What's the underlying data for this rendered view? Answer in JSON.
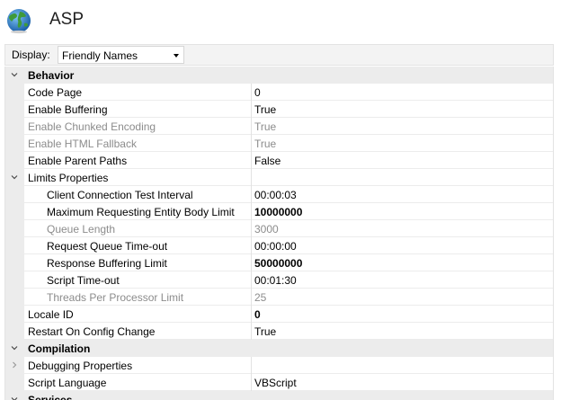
{
  "header": {
    "title": "ASP"
  },
  "toolbar": {
    "display_label": "Display:",
    "display_value": "Friendly Names"
  },
  "rows": [
    {
      "kind": "category",
      "label": "Behavior",
      "expanded": true
    },
    {
      "kind": "property",
      "label": "Code Page",
      "value": "0",
      "level": 1
    },
    {
      "kind": "property",
      "label": "Enable Buffering",
      "value": "True",
      "level": 1
    },
    {
      "kind": "property",
      "label": "Enable Chunked Encoding",
      "value": "True",
      "level": 1,
      "disabled": true
    },
    {
      "kind": "property",
      "label": "Enable HTML Fallback",
      "value": "True",
      "level": 1,
      "disabled": true
    },
    {
      "kind": "property",
      "label": "Enable Parent Paths",
      "value": "False",
      "level": 1
    },
    {
      "kind": "group",
      "label": "Limits Properties",
      "value": "",
      "level": 1,
      "expanded": true
    },
    {
      "kind": "property",
      "label": "Client Connection Test Interval",
      "value": "00:00:03",
      "level": 2
    },
    {
      "kind": "property",
      "label": "Maximum Requesting Entity Body Limit",
      "value": "10000000",
      "level": 2,
      "bold": true
    },
    {
      "kind": "property",
      "label": "Queue Length",
      "value": "3000",
      "level": 2,
      "disabled": true
    },
    {
      "kind": "property",
      "label": "Request Queue Time-out",
      "value": "00:00:00",
      "level": 2
    },
    {
      "kind": "property",
      "label": "Response Buffering Limit",
      "value": "50000000",
      "level": 2,
      "bold": true
    },
    {
      "kind": "property",
      "label": "Script Time-out",
      "value": "00:01:30",
      "level": 2
    },
    {
      "kind": "property",
      "label": "Threads Per Processor Limit",
      "value": "25",
      "level": 2,
      "disabled": true
    },
    {
      "kind": "property",
      "label": "Locale ID",
      "value": "0",
      "level": 1,
      "bold": true
    },
    {
      "kind": "property",
      "label": "Restart On Config Change",
      "value": "True",
      "level": 1
    },
    {
      "kind": "category",
      "label": "Compilation",
      "expanded": true
    },
    {
      "kind": "group",
      "label": "Debugging Properties",
      "value": "",
      "level": 1,
      "expanded": false
    },
    {
      "kind": "property",
      "label": "Script Language",
      "value": "VBScript",
      "level": 1
    },
    {
      "kind": "category",
      "label": "Services",
      "expanded": true
    }
  ]
}
